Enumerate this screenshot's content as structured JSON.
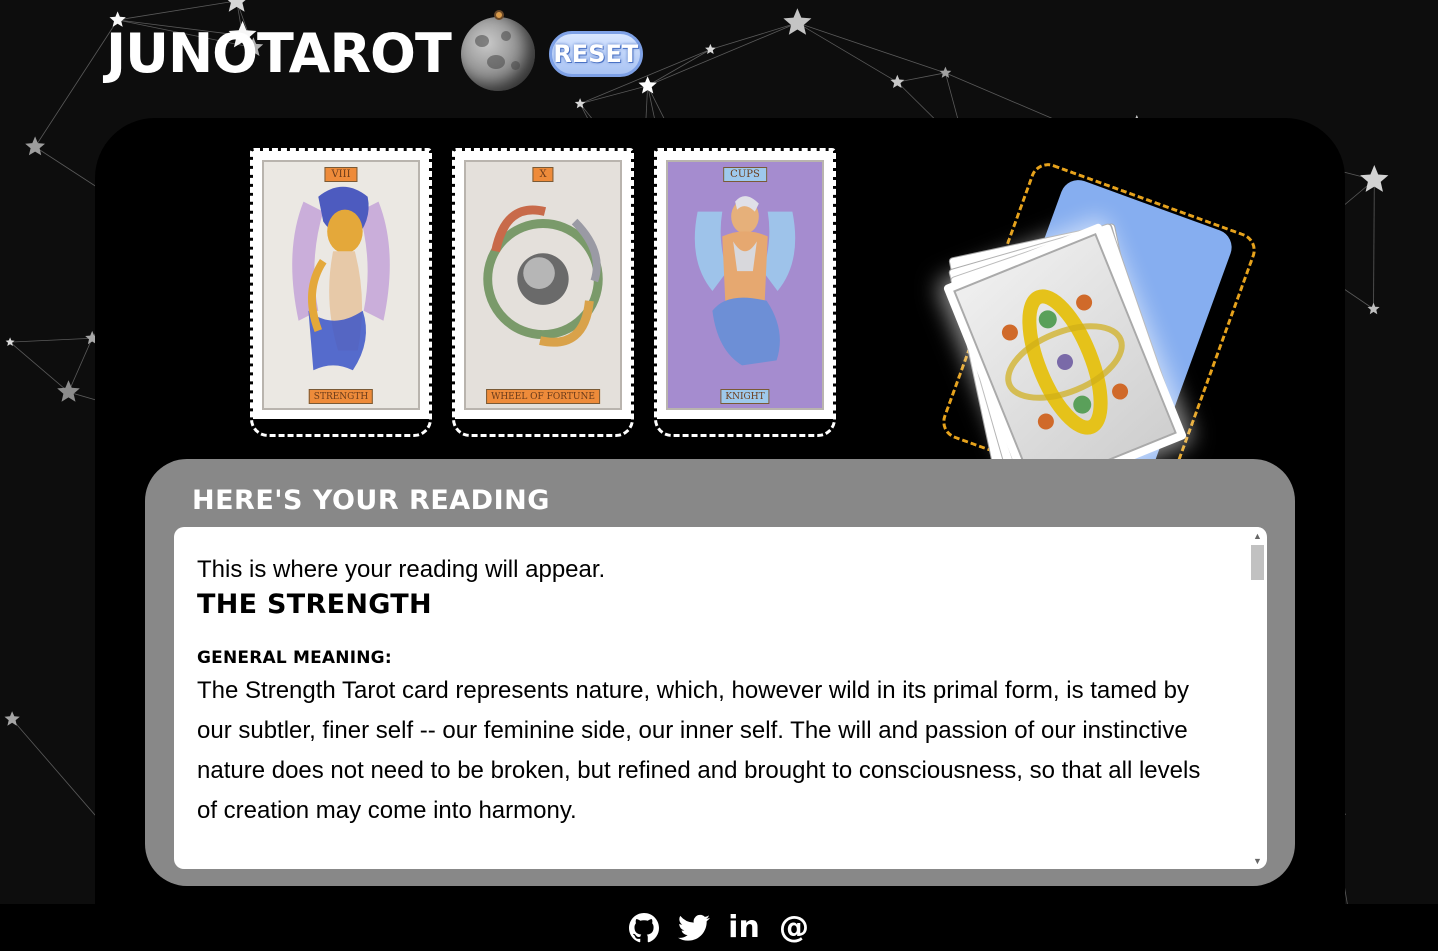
{
  "header": {
    "logo_text": "JUNOTAROT",
    "reset_label": "RESET"
  },
  "cards": [
    {
      "number": "VIII",
      "name": "STRENGTH",
      "label_color": "#ee8b3a",
      "bg": "#e9e6e1"
    },
    {
      "number": "X",
      "name": "WHEEL OF FORTUNE",
      "label_color": "#ee8b3a",
      "bg": "#e3dfda"
    },
    {
      "number": "CUPS",
      "name": "KNIGHT",
      "label_color": "#9ec9ec",
      "bg": "#a58ccf"
    }
  ],
  "reading": {
    "title": "HERE'S YOUR READING",
    "intro": "This is where your reading will appear.",
    "card_title": "THE STRENGTH",
    "section_label": "GENERAL MEANING:",
    "meaning": "The Strength Tarot card represents nature, which, however wild in its primal form, is tamed by our subtler, finer self -- our feminine side, our inner self. The will and passion of our instinctive nature does not need to be broken, but refined and brought to consciousness, so that all levels of creation may come into harmony."
  },
  "footer": {
    "icons": [
      "github-icon",
      "twitter-icon",
      "linkedin-icon",
      "email-icon"
    ],
    "linkedin_text": "in",
    "email_text": "@"
  },
  "colors": {
    "background": "#0d0d0d",
    "panel": "#000000",
    "reading_panel": "#888888",
    "reset_button": "#a9c3f3",
    "deck_outline": "#e6a21c",
    "deck_blue": "#86aef0"
  }
}
